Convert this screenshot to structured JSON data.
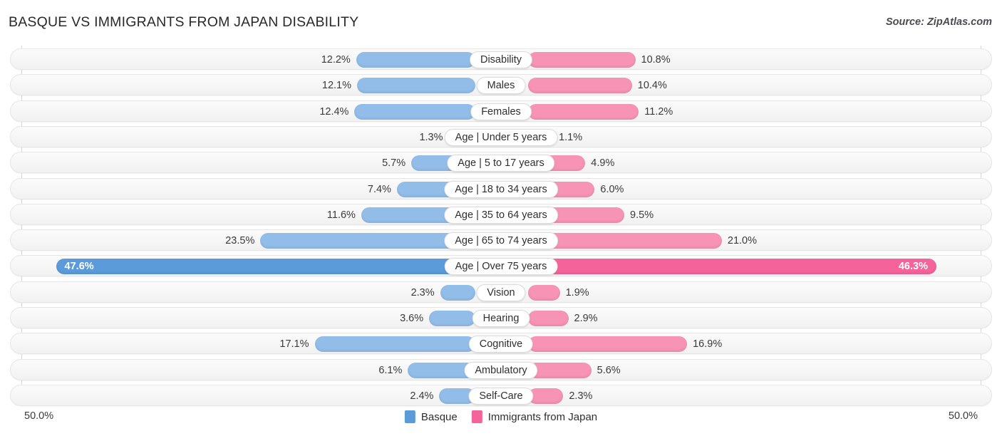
{
  "header": {
    "title": "BASQUE VS IMMIGRANTS FROM JAPAN DISABILITY",
    "source": "Source: ZipAtlas.com"
  },
  "axis": {
    "left_label": "50.0%",
    "right_label": "50.0%"
  },
  "legend": {
    "items": [
      {
        "label": "Basque",
        "color": "#5b9bd9"
      },
      {
        "label": "Immigrants from Japan",
        "color": "#f4639a"
      }
    ]
  },
  "colors": {
    "left_bar": "#92bde8",
    "right_bar": "#f793b4",
    "left_bar_highlight": "#5b9bd9",
    "right_bar_highlight": "#f4639a",
    "track": "#f6f6f6",
    "gridline": "#d8d8d8"
  },
  "chart_data": {
    "type": "bar",
    "title": "BASQUE VS IMMIGRANTS FROM JAPAN DISABILITY",
    "subtitle": "Source: ZipAtlas.com",
    "orientation": "horizontal-diverging",
    "xlabel": "",
    "ylabel": "",
    "xlim": [
      50.0,
      50.0
    ],
    "grid": true,
    "legend_position": "bottom-center",
    "categories": [
      "Disability",
      "Males",
      "Females",
      "Age | Under 5 years",
      "Age | 5 to 17 years",
      "Age | 18 to 34 years",
      "Age | 35 to 64 years",
      "Age | 65 to 74 years",
      "Age | Over 75 years",
      "Vision",
      "Hearing",
      "Cognitive",
      "Ambulatory",
      "Self-Care"
    ],
    "series": [
      {
        "name": "Basque",
        "color": "#92bde8",
        "values": [
          12.2,
          12.1,
          12.4,
          1.3,
          5.7,
          7.4,
          11.6,
          23.5,
          47.6,
          2.3,
          3.6,
          17.1,
          6.1,
          2.4
        ],
        "labels": [
          "12.2%",
          "12.1%",
          "12.4%",
          "1.3%",
          "5.7%",
          "7.4%",
          "11.6%",
          "23.5%",
          "47.6%",
          "2.3%",
          "3.6%",
          "17.1%",
          "6.1%",
          "2.4%"
        ]
      },
      {
        "name": "Immigrants from Japan",
        "color": "#f793b4",
        "values": [
          10.8,
          10.4,
          11.2,
          1.1,
          4.9,
          6.0,
          9.5,
          21.0,
          46.3,
          1.9,
          2.9,
          16.9,
          5.6,
          2.3
        ],
        "labels": [
          "10.8%",
          "10.4%",
          "11.2%",
          "1.1%",
          "4.9%",
          "6.0%",
          "9.5%",
          "21.0%",
          "46.3%",
          "1.9%",
          "2.9%",
          "16.9%",
          "5.6%",
          "2.3%"
        ]
      }
    ],
    "highlighted_row": "Age | Over 75 years"
  }
}
